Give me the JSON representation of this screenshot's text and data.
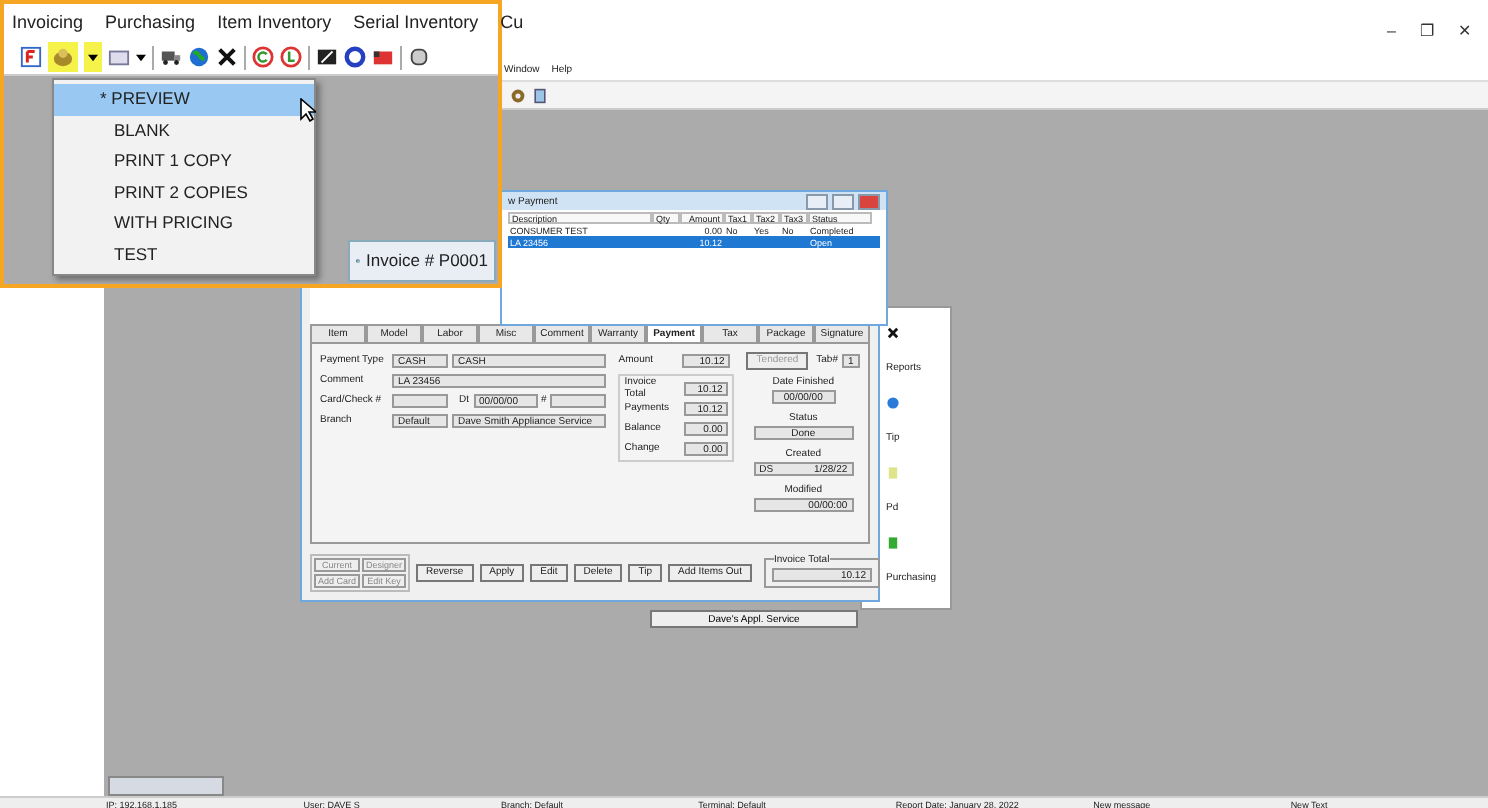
{
  "app": {
    "menu": [
      "Window",
      "Help"
    ],
    "window_controls": [
      "–",
      "❐",
      "✕"
    ]
  },
  "callout": {
    "menu": [
      "Invoicing",
      "Purchasing",
      "Item Inventory",
      "Serial Inventory",
      "Cu"
    ],
    "dropdown": [
      {
        "label": "* PREVIEW",
        "selected": true
      },
      {
        "label": "BLANK",
        "selected": false
      },
      {
        "label": "PRINT 1 COPY",
        "selected": false
      },
      {
        "label": "PRINT 2 COPIES",
        "selected": false
      },
      {
        "label": "WITH PRICING",
        "selected": false
      },
      {
        "label": "TEST",
        "selected": false
      }
    ],
    "invoice_title": "Invoice # P0001"
  },
  "payment_window": {
    "title": "w Payment",
    "columns": [
      "Description",
      "Qty",
      "Amount",
      "Tax1",
      "Tax2",
      "Tax3",
      "Status"
    ],
    "rows": [
      {
        "cells": [
          "CONSUMER TEST",
          "",
          "0.00",
          "No",
          "Yes",
          "No",
          "Completed"
        ],
        "selected": false
      },
      {
        "cells": [
          "LA 23456",
          "",
          "10.12",
          "",
          "",
          "",
          "Open"
        ],
        "selected": true
      }
    ]
  },
  "invoice_window": {
    "tabs": [
      {
        "label": "Item",
        "selected": false
      },
      {
        "label": "Model",
        "selected": false
      },
      {
        "label": "Labor",
        "selected": false
      },
      {
        "label": "Misc",
        "selected": false
      },
      {
        "label": "Comment",
        "selected": false
      },
      {
        "label": "Warranty",
        "selected": false
      },
      {
        "label": "Payment",
        "selected": true
      },
      {
        "label": "Tax",
        "selected": false
      },
      {
        "label": "Package",
        "selected": false
      },
      {
        "label": "Signature",
        "selected": false
      }
    ],
    "payment_type": {
      "label": "Payment Type",
      "code": "CASH",
      "name": "CASH"
    },
    "comment": {
      "label": "Comment",
      "value": "LA 23456"
    },
    "card": {
      "label": "Card/Check #",
      "date_label": "Dt",
      "date": "00/00/00",
      "num_label": "#"
    },
    "branch": {
      "label": "Branch",
      "code": "Default",
      "name": "Dave Smith Appliance Service"
    },
    "amount": {
      "label": "Amount",
      "value": "10.12",
      "button": "Tendered"
    },
    "tab_no": {
      "label": "Tab#",
      "value": "1"
    },
    "totals": [
      {
        "label": "Invoice Total",
        "value": "10.12"
      },
      {
        "label": "Payments",
        "value": "10.12"
      },
      {
        "label": "Balance",
        "value": "0.00"
      },
      {
        "label": "Change",
        "value": "0.00"
      }
    ],
    "date_finished": {
      "label": "Date Finished",
      "value": "00/00/00"
    },
    "status": {
      "label": "Status",
      "value": "Done"
    },
    "created": {
      "label": "Created",
      "by": "DS",
      "date": "1/28/22"
    },
    "modified": {
      "label": "Modified",
      "date": "00/00:00"
    },
    "side_buttons": [
      "Current",
      "Designer",
      "Add Card",
      "Edit Key"
    ],
    "buttons": [
      "Reverse",
      "Apply",
      "Edit",
      "Delete",
      "Tip",
      "Add Items Out"
    ],
    "invoice_total": {
      "label": "Invoice Total",
      "value": "10.12"
    }
  },
  "back_panel": {
    "labels": [
      "Reports",
      "Tip",
      "Pd",
      "Purchasing"
    ],
    "button": "Dave's Appl. Service"
  },
  "status_bar": [
    "IP: 192.168.1.185",
    "User: DAVE S",
    "Branch: Default",
    "Terminal: Default",
    "Report Date: January 28, 2022",
    "New message",
    "New Text"
  ]
}
